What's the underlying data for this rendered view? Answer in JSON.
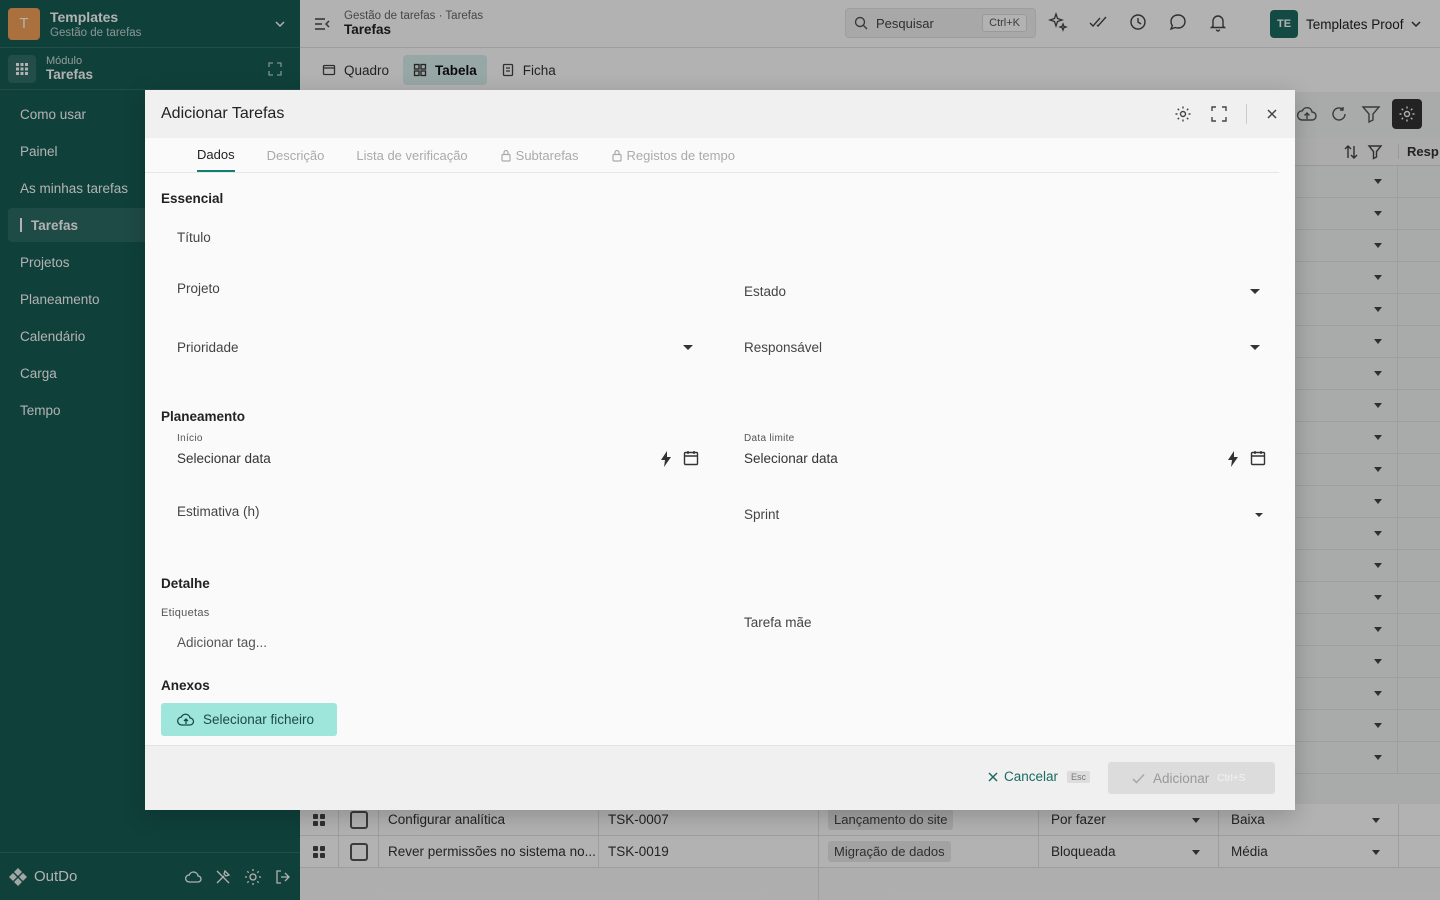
{
  "workspace": {
    "logo_letter": "T",
    "title": "Templates",
    "subtitle": "Gestão de tarefas"
  },
  "module": {
    "label": "Módulo",
    "name": "Tarefas"
  },
  "nav": {
    "items": [
      "Como usar",
      "Painel",
      "As minhas tarefas",
      "Tarefas",
      "Projetos",
      "Planeamento",
      "Calendário",
      "Carga",
      "Tempo"
    ],
    "active": "Tarefas"
  },
  "footer": {
    "brand": "OutDo"
  },
  "topbar": {
    "breadcrumb_parent": "Gestão de tarefas · Tarefas",
    "breadcrumb_current": "Tarefas",
    "search_placeholder": "Pesquisar",
    "search_shortcut": "Ctrl+K",
    "user_initials": "TE",
    "user_name": "Templates Proof"
  },
  "view_tabs": [
    "Quadro",
    "Tabela",
    "Ficha"
  ],
  "active_view": "Tabela",
  "table": {
    "col_responsavel": "Resp",
    "rows": [
      {
        "name": "Configurar analítica",
        "id": "TSK-0007",
        "project": "Lançamento do site",
        "status": "Por fazer",
        "priority": "Baixa"
      },
      {
        "name": "Rever permissões no sistema no...",
        "id": "TSK-0019",
        "project": "Migração de dados",
        "status": "Bloqueada",
        "priority": "Média"
      }
    ]
  },
  "modal": {
    "title": "Adicionar Tarefas",
    "tabs": [
      "Dados",
      "Descrição",
      "Lista de verificação",
      "Subtarefas",
      "Registos de tempo"
    ],
    "active_tab": "Dados",
    "sections": {
      "essencial": "Essencial",
      "planeamento": "Planeamento",
      "detalhe": "Detalhe",
      "anexos": "Anexos"
    },
    "fields": {
      "titulo": "Título",
      "projeto": "Projeto",
      "estado": "Estado",
      "prioridade": "Prioridade",
      "responsavel": "Responsável",
      "inicio_label": "Início",
      "inicio_value": "Selecionar data",
      "data_limite_label": "Data limite",
      "data_limite_value": "Selecionar data",
      "estimativa": "Estimativa (h)",
      "sprint": "Sprint",
      "etiquetas_label": "Etiquetas",
      "etiquetas_placeholder": "Adicionar tag...",
      "tarefa_mae": "Tarefa mãe"
    },
    "file_button": "Selecionar ficheiro",
    "cancel_label": "Cancelar",
    "cancel_shortcut": "Esc",
    "add_label": "Adicionar",
    "add_shortcut": "Ctrl+S"
  },
  "colors": {
    "sidebar": "#165c54",
    "accent": "#0e7f73",
    "file_button": "#9ee6dc"
  }
}
